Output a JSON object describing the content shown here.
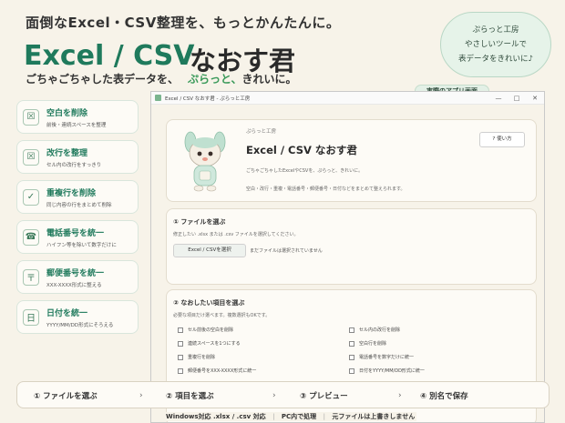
{
  "headline": "面倒なExcel・CSV整理を、もっとかんたんに。",
  "title_en": "Excel / CSV",
  "title_ja": "なおす君",
  "subhead": "ごちゃごちゃした表データを、",
  "subhead_accent": "ぷらっと、",
  "subhead_end": "きれいに。",
  "brand": {
    "line1": "ぷらっと工房",
    "line2": "やさしいツールで",
    "line3": "表データをきれいに♪"
  },
  "real_label": "実際のアプリ画面",
  "features": [
    {
      "icon": "☒",
      "title": "空白を削除",
      "desc": "前後・連続スペースを整理"
    },
    {
      "icon": "☒",
      "title": "改行を整理",
      "desc": "セル内の改行をすっきり"
    },
    {
      "icon": "✓",
      "title": "重複行を削除",
      "desc": "同じ内容の行をまとめて削除"
    },
    {
      "icon": "☎",
      "title": "電話番号を統一",
      "desc": "ハイフン等を除いて数字だけに"
    },
    {
      "icon": "〒",
      "title": "郵便番号を統一",
      "desc": "XXX-XXXX形式に整える"
    },
    {
      "icon": "日",
      "title": "日付を統一",
      "desc": "YYYY/MM/DD形式にそろえる"
    }
  ],
  "window": {
    "title": "Excel / CSV なおす君 - ぷらっと工房",
    "minimize": "—",
    "maximize": "□",
    "close": "✕"
  },
  "hero": {
    "tag": "ぷらっと工房",
    "title": "Excel / CSV なおす君",
    "desc1": "ごちゃごちゃしたExcelやCSVを、ぷらっと、きれいに。",
    "desc2": "空白・改行・重複・電話番号・郵便番号・日付などをまとめて整えられます。",
    "help": "? 使い方"
  },
  "step1": {
    "title": "① ファイルを選ぶ",
    "note": "修正したい .xlsx または .csv ファイルを選択してください。",
    "button": "Excel / CSVを選択",
    "status": "まだファイルは選択されていません"
  },
  "step2": {
    "title": "② なおしたい項目を選ぶ",
    "note": "必要な項目だけ選べます。複数選択もOKです。",
    "options": [
      [
        "セル前後の空白を削除",
        "セル内の改行を削除"
      ],
      [
        "連続スペースを1つにする",
        "空白行を削除"
      ],
      [
        "重複行を削除",
        "電話番号を数字だけに統一"
      ],
      [
        "郵便番号をXXX-XXXX形式に統一",
        "日付をYYYY/MM/DD形式に統一"
      ]
    ]
  },
  "steps": [
    "① ファイルを選ぶ",
    "② 項目を選ぶ",
    "③ プレビュー",
    "④ 別名で保存"
  ],
  "footer": {
    "a": "Windows対応",
    "b": "PC内で処理",
    "c": "元ファイルは上書きしません",
    "extra": ".xlsx / .csv 対応"
  }
}
